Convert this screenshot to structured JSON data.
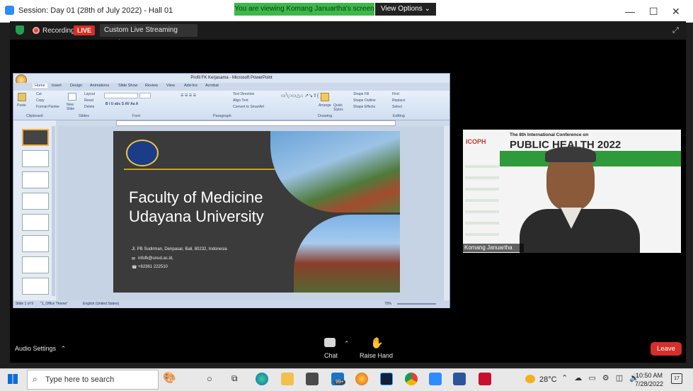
{
  "window": {
    "title": "Session: Day 01 (28th of July 2022) - Hall 01",
    "sharing_banner": "You are viewing Komang Januartha's screen",
    "view_options": "View Options"
  },
  "meeting": {
    "recording_label": "Recording",
    "live_badge": "LIVE",
    "stream_menu": "Custom Live Streaming Service"
  },
  "ppt": {
    "title": "Profil FK Kerjasama - Microsoft PowerPoint",
    "tabs": [
      "Home",
      "Insert",
      "Design",
      "Animations",
      "Slide Show",
      "Review",
      "View",
      "Add-Ins",
      "Acrobat"
    ],
    "groups": [
      "Clipboard",
      "Slides",
      "Font",
      "Paragraph",
      "Drawing",
      "Editing"
    ],
    "ribbon_items": {
      "paste": "Paste",
      "cut": "Cut",
      "copy": "Copy",
      "format_painter": "Format Painter",
      "new_slide": "New Slide",
      "layout": "Layout",
      "reset": "Reset",
      "delete": "Delete",
      "text_direction": "Text Direction",
      "align_text": "Align Text",
      "convert_smartart": "Convert to SmartArt",
      "arrange": "Arrange",
      "quick_styles": "Quick Styles",
      "shape_fill": "Shape Fill",
      "shape_outline": "Shape Outline",
      "shape_effects": "Shape Effects",
      "find": "Find",
      "replace": "Replace",
      "select": "Select"
    },
    "status": {
      "slide": "Slide 1 of 9",
      "theme": "\"1_Office Theme\"",
      "language": "English (United States)",
      "zoom": "70%"
    },
    "slide": {
      "title_line1": "Faculty of Medicine",
      "title_line2": "Udayana University",
      "address": "Jl. PB Sudirman, Denpasar, Bali, 80232, Indonesia",
      "email": "infofk@unud.ac.id,",
      "phone": "+62361 222510"
    }
  },
  "video": {
    "header1": "The 8th International Conference on",
    "header2": "PUBLIC HEALTH 2022",
    "logo": "ICOPH",
    "participant": "Komang Januartha"
  },
  "controls": {
    "audio_settings": "Audio Settings",
    "chat": "Chat",
    "raise_hand": "Raise Hand",
    "leave": "Leave"
  },
  "taskbar": {
    "search_placeholder": "Type here to search",
    "weather": "28°C",
    "time": "10:50 AM",
    "date": "7/28/2022",
    "notifications": "17",
    "mail_badge": "99+"
  },
  "colors": {
    "live_red": "#d92d26",
    "banner_green": "#3cb94a",
    "leave_red": "#d42f2a"
  }
}
